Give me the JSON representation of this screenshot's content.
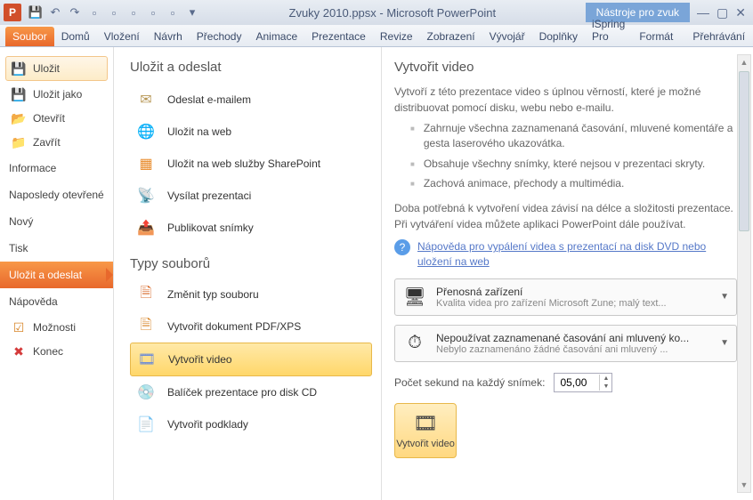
{
  "titlebar": {
    "title": "Zvuky 2010.ppsx - Microsoft PowerPoint",
    "context_tab": "Nástroje pro zvuk"
  },
  "ribbon": {
    "tabs": [
      "Soubor",
      "Domů",
      "Vložení",
      "Návrh",
      "Přechody",
      "Animace",
      "Prezentace",
      "Revize",
      "Zobrazení",
      "Vývojář",
      "Doplňky",
      "iSpring Pro",
      "Formát",
      "Přehrávání"
    ]
  },
  "leftnav": {
    "save": "Uložit",
    "save_as": "Uložit jako",
    "open": "Otevřít",
    "close": "Zavřít",
    "info": "Informace",
    "recent": "Naposledy otevřené",
    "new": "Nový",
    "print": "Tisk",
    "save_send": "Uložit a odeslat",
    "help": "Nápověda",
    "options": "Možnosti",
    "exit": "Konec"
  },
  "mid": {
    "header1": "Uložit a odeslat",
    "items1": [
      {
        "label": "Odeslat e-mailem"
      },
      {
        "label": "Uložit na web"
      },
      {
        "label": "Uložit na web služby SharePoint"
      },
      {
        "label": "Vysílat prezentaci"
      },
      {
        "label": "Publikovat snímky"
      }
    ],
    "header2": "Typy souborů",
    "items2": [
      {
        "label": "Změnit typ souboru"
      },
      {
        "label": "Vytvořit dokument PDF/XPS"
      },
      {
        "label": "Vytvořit video"
      },
      {
        "label": "Balíček prezentace pro disk CD"
      },
      {
        "label": "Vytvořit podklady"
      }
    ]
  },
  "right": {
    "title": "Vytvořit video",
    "desc": "Vytvoří z této prezentace video s úplnou věrností, které je možné distribuovat pomocí disku, webu nebo e-mailu.",
    "bullets": [
      "Zahrnuje všechna zaznamenaná časování, mluvené komentáře a gesta laserového ukazovátka.",
      "Obsahuje všechny snímky, které nejsou v prezentaci skryty.",
      "Zachová animace, přechody a multimédia."
    ],
    "desc2": "Doba potřebná k vytvoření videa závisí na délce a složitosti prezentace. Při vytváření videa můžete aplikaci PowerPoint dále používat.",
    "link": "Nápověda pro vypálení videa s prezentací na disk DVD nebo uložení na web",
    "option1": {
      "title": "Přenosná zařízení",
      "sub": "Kvalita videa pro zařízení Microsoft Zune; malý text..."
    },
    "option2": {
      "title": "Nepoužívat zaznamenané časování ani mluvený ko...",
      "sub": "Nebylo zaznamenáno žádné časování ani mluvený ..."
    },
    "seconds_label": "Počet sekund na každý snímek:",
    "seconds_value": "05,00",
    "button": "Vytvořit video"
  }
}
